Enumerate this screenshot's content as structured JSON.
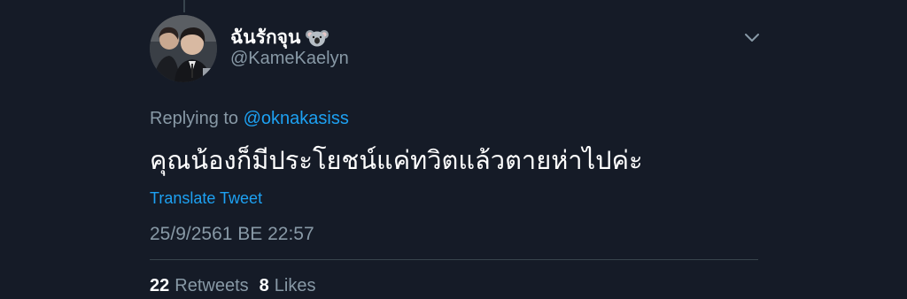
{
  "colors": {
    "background": "#151b27",
    "text_primary": "#ffffff",
    "text_secondary": "#8899a6",
    "accent": "#1da1f2",
    "divider": "#38444d"
  },
  "author": {
    "display_name": "ฉันรักจุน",
    "name_emoji": "koala-emoji",
    "handle": "@KameKaelyn",
    "avatar": "avatar-photo"
  },
  "reply": {
    "prefix": "Replying to",
    "mention": "@oknakasiss"
  },
  "tweet": {
    "text": "คุณน้องก็มีประโยชน์แค่ทวิตแล้วตายห่าไปค่ะ",
    "translate_label": "Translate Tweet",
    "timestamp": "25/9/2561 BE 22:57"
  },
  "stats": {
    "retweets_count": "22",
    "retweets_label": "Retweets",
    "likes_count": "8",
    "likes_label": "Likes"
  },
  "menu": {
    "icon": "chevron-down-icon"
  }
}
